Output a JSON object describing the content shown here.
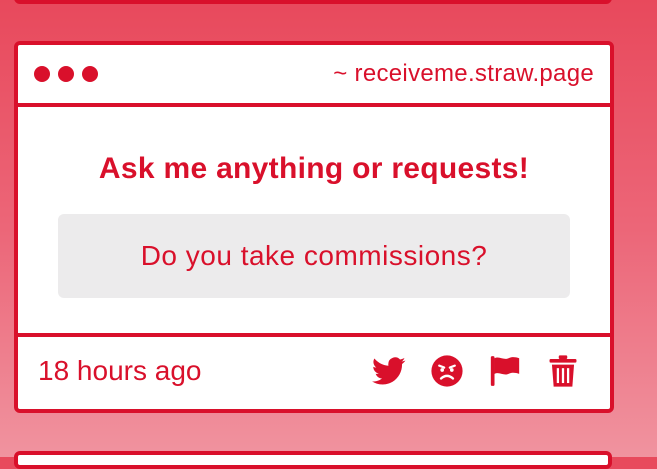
{
  "card": {
    "url": "~ receiveme.straw.page",
    "prompt": "Ask me anything or requests!",
    "question": "Do you take commissions?",
    "timestamp": "18 hours ago",
    "icons": [
      "twitter-icon",
      "angry-face-icon",
      "flag-icon",
      "trash-icon"
    ]
  },
  "colors": {
    "accent": "#d9102b",
    "question_bg": "#ecebec",
    "background_top": "#e8495c",
    "background_bottom": "#f0939f"
  }
}
